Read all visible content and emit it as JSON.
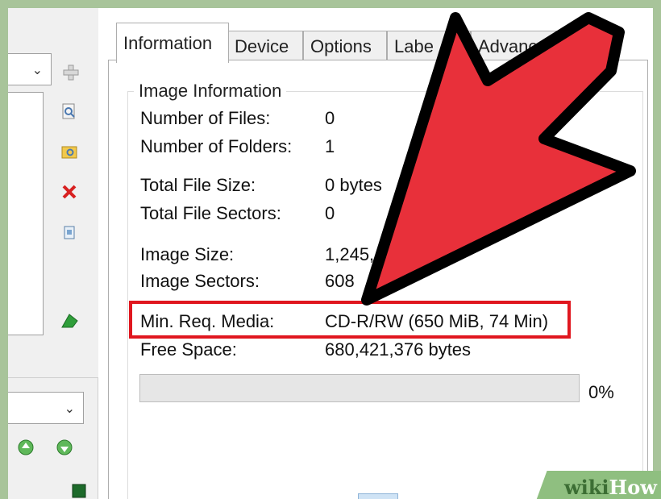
{
  "tabs": [
    "Information",
    "Device",
    "Options",
    "Labe",
    "Advanced"
  ],
  "group_title": "Image Information",
  "rows": {
    "files_label": "Number of Files:",
    "files_value": "0",
    "folders_label": "Number of Folders:",
    "folders_value": "1",
    "file_size_label": "Total File Size:",
    "file_size_value": "0 bytes",
    "file_sectors_label": "Total File Sectors:",
    "file_sectors_value": "0",
    "image_size_label": "Image Size:",
    "image_size_value": "1,245,",
    "image_sectors_label": "Image Sectors:",
    "image_sectors_value": "608",
    "min_media_label": "Min. Req. Media:",
    "min_media_value": "CD-R/RW (650 MiB, 74 Min)",
    "free_space_label": "Free Space:",
    "free_space_value": "680,421,376 bytes"
  },
  "progress": {
    "fraction": 0,
    "label": "0%"
  },
  "watermark": {
    "part1": "wiki",
    "part2": "How"
  },
  "colors": {
    "highlight": "#e0171f",
    "arrow_fill": "#e8303a",
    "arrow_outline": "#000000",
    "frame": "#a8c49a"
  },
  "icons": [
    "chevron-down-icon",
    "add-icon",
    "browse-icon",
    "folder-browse-icon",
    "delete-icon",
    "recycle-icon",
    "build-icon",
    "move-up-icon",
    "move-down-icon",
    "status-icon"
  ]
}
